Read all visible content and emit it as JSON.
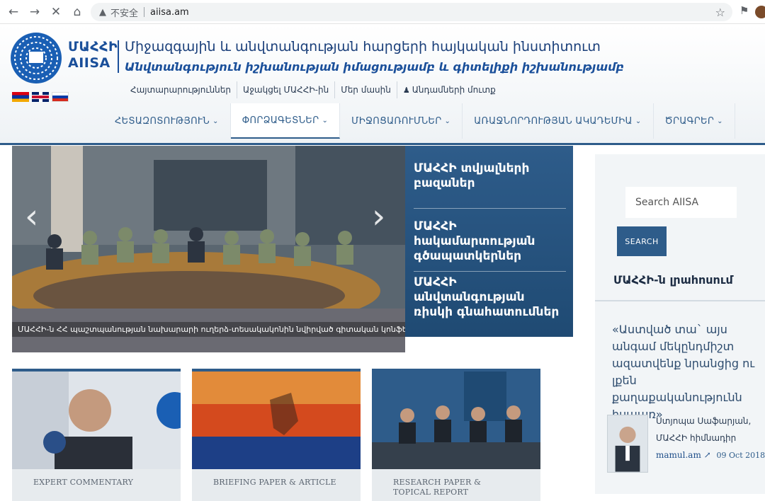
{
  "browser": {
    "security_label": "不安全",
    "url": "aiisa.am"
  },
  "site": {
    "logo_text_1": "ՄԱՀՀԻ",
    "logo_text_2": "AIISA",
    "title": "Միջազգային և անվտանգության հարցերի հայկական ինստիտուտ",
    "subtitle": "Անվտանգություն իշխանության իմացությամբ և գիտելիքի իշխանությամբ"
  },
  "util_links": [
    "Հայտարարություններ",
    "Աջակցել ՄԱՀՀԻ-ին",
    "Մեր մասին",
    "Անդամների մուտք"
  ],
  "main_nav": [
    {
      "label": "ՀԵՏԱԶՈՏՈՒԹՅՈՒՆ"
    },
    {
      "label": "ՓՈՐՁԱԳԵՏՆԵՐ"
    },
    {
      "label": "ՄԻՋՈՑԱՌՈՒՄՆԵՐ"
    },
    {
      "label": "ԱՌԱՋՆՈՐԴՈՒԹՅԱՆ ԱԿԱԴԵՄԻԱ"
    },
    {
      "label": "ԾՐԱԳՐԵՐ"
    }
  ],
  "slider": {
    "caption": "ՄԱՀՀԻ-ն ՀՀ պաշտպանության նախարարի ուղերձ-տեսակակոնին նվիրված գիտական կոնֆերանսում"
  },
  "side_panel": [
    "ՄԱՀՀԻ տվյալների բազաներ",
    "ՄԱՀՀԻ հակամարտության գծապատկերներ",
    "ՄԱՀՀԻ անվտանգության ռիսկի գնահատումներ"
  ],
  "sidebar": {
    "search_placeholder": "Search AIISA",
    "search_button": "SEARCH",
    "heading": "ՄԱՀՀԻ-ն լրահոսում",
    "quote": "«Աստված տա` այս անգամ մեկընդմիշտ ազատվենք նրանցից ու լքեն քաղաքականությունն իսպառ»",
    "author_name": "Ստյոպա Սաֆարյան,",
    "author_role": "ՄԱՀՀԻ հիմնադիր",
    "source": "mamul.am",
    "date": "09 Oct 2018"
  },
  "cards": [
    {
      "label": "EXPERT COMMENTARY"
    },
    {
      "label": "BRIEFING PAPER & ARTICLE"
    },
    {
      "label": "RESEARCH PAPER & TOPICAL REPORT"
    }
  ],
  "colors": {
    "brand": "#2e5c8a",
    "brand_dark": "#1f4a73",
    "logo_blue": "#1a4f9a"
  }
}
